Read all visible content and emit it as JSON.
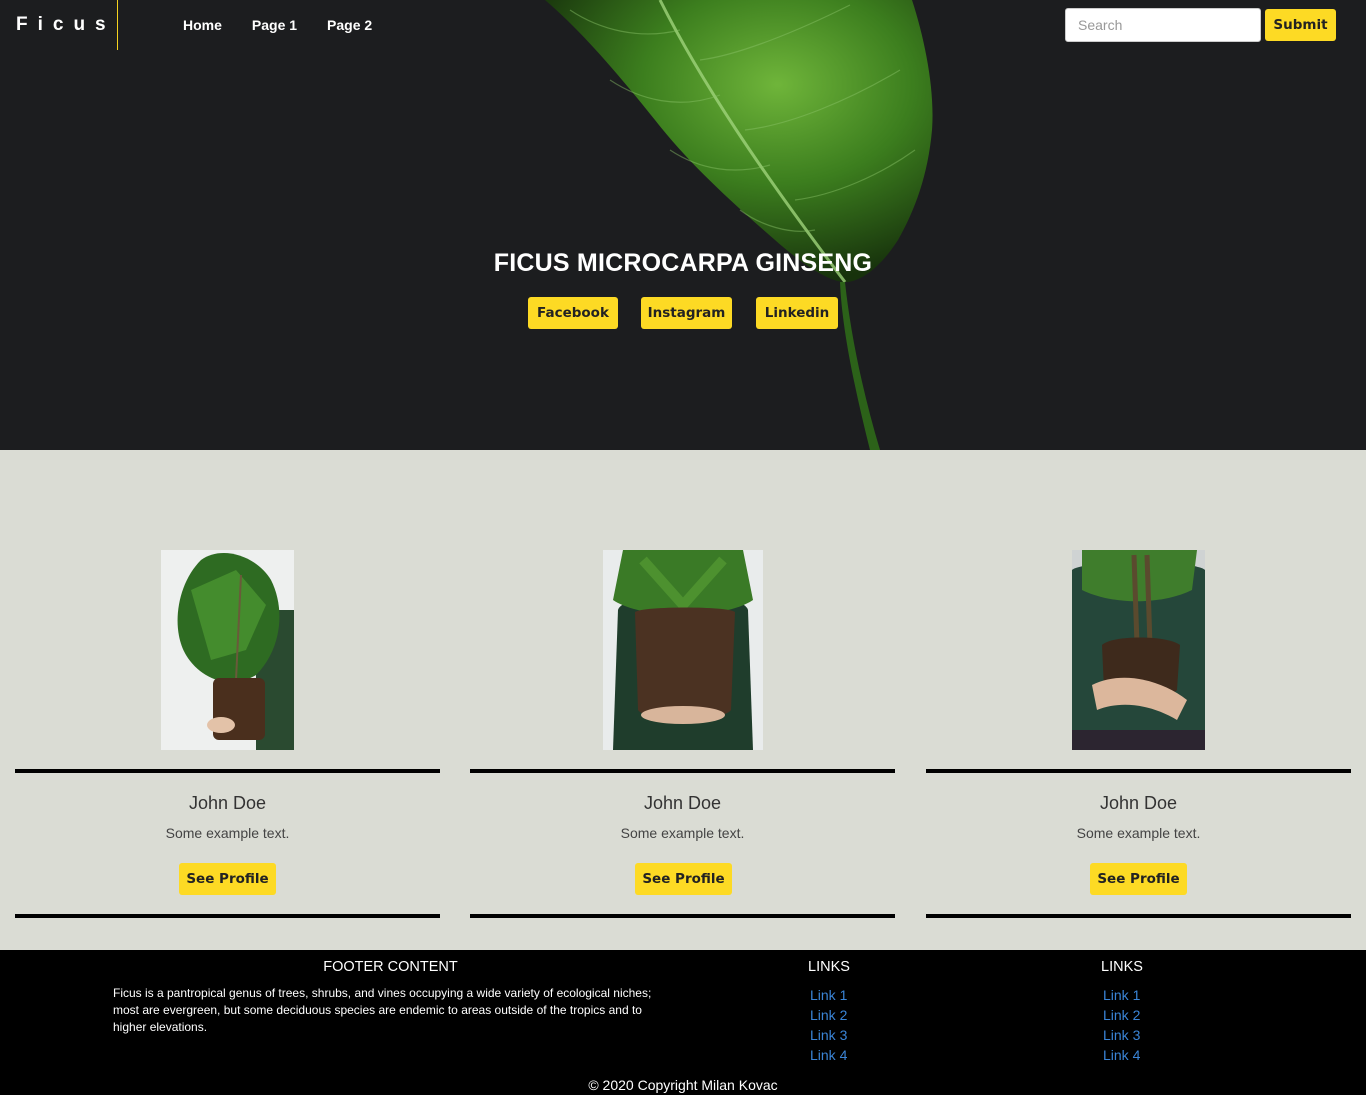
{
  "nav": {
    "brand": "Ficus",
    "links": [
      "Home",
      "Page 1",
      "Page 2"
    ],
    "search_placeholder": "Search",
    "submit_label": "Submit"
  },
  "hero": {
    "title": "FICUS MICROCARPA GINSENG",
    "social": [
      "Facebook",
      "Instagram",
      "Linkedin"
    ]
  },
  "cards": [
    {
      "name": "John Doe",
      "text": "Some example text.",
      "button": "See Profile"
    },
    {
      "name": "John Doe",
      "text": "Some example text.",
      "button": "See Profile"
    },
    {
      "name": "John Doe",
      "text": "Some example text.",
      "button": "See Profile"
    }
  ],
  "footer": {
    "heading": "FOOTER CONTENT",
    "description": "Ficus is a pantropical genus of trees, shrubs, and vines occupying a wide variety of ecological niches; most are evergreen, but some deciduous species are endemic to areas outside of the tropics and to higher elevations.",
    "link_groups": [
      {
        "heading": "LINKS",
        "links": [
          "Link 1",
          "Link 2",
          "Link 3",
          "Link 4"
        ]
      },
      {
        "heading": "LINKS",
        "links": [
          "Link 1",
          "Link 2",
          "Link 3",
          "Link 4"
        ]
      }
    ],
    "copyright": "© 2020 Copyright Milan Kovac"
  },
  "colors": {
    "accent": "#fdda24",
    "hero_bg": "#1c1d1f",
    "content_bg": "#dadcd4",
    "footer_bg": "#000000",
    "link": "#3a84d6"
  }
}
